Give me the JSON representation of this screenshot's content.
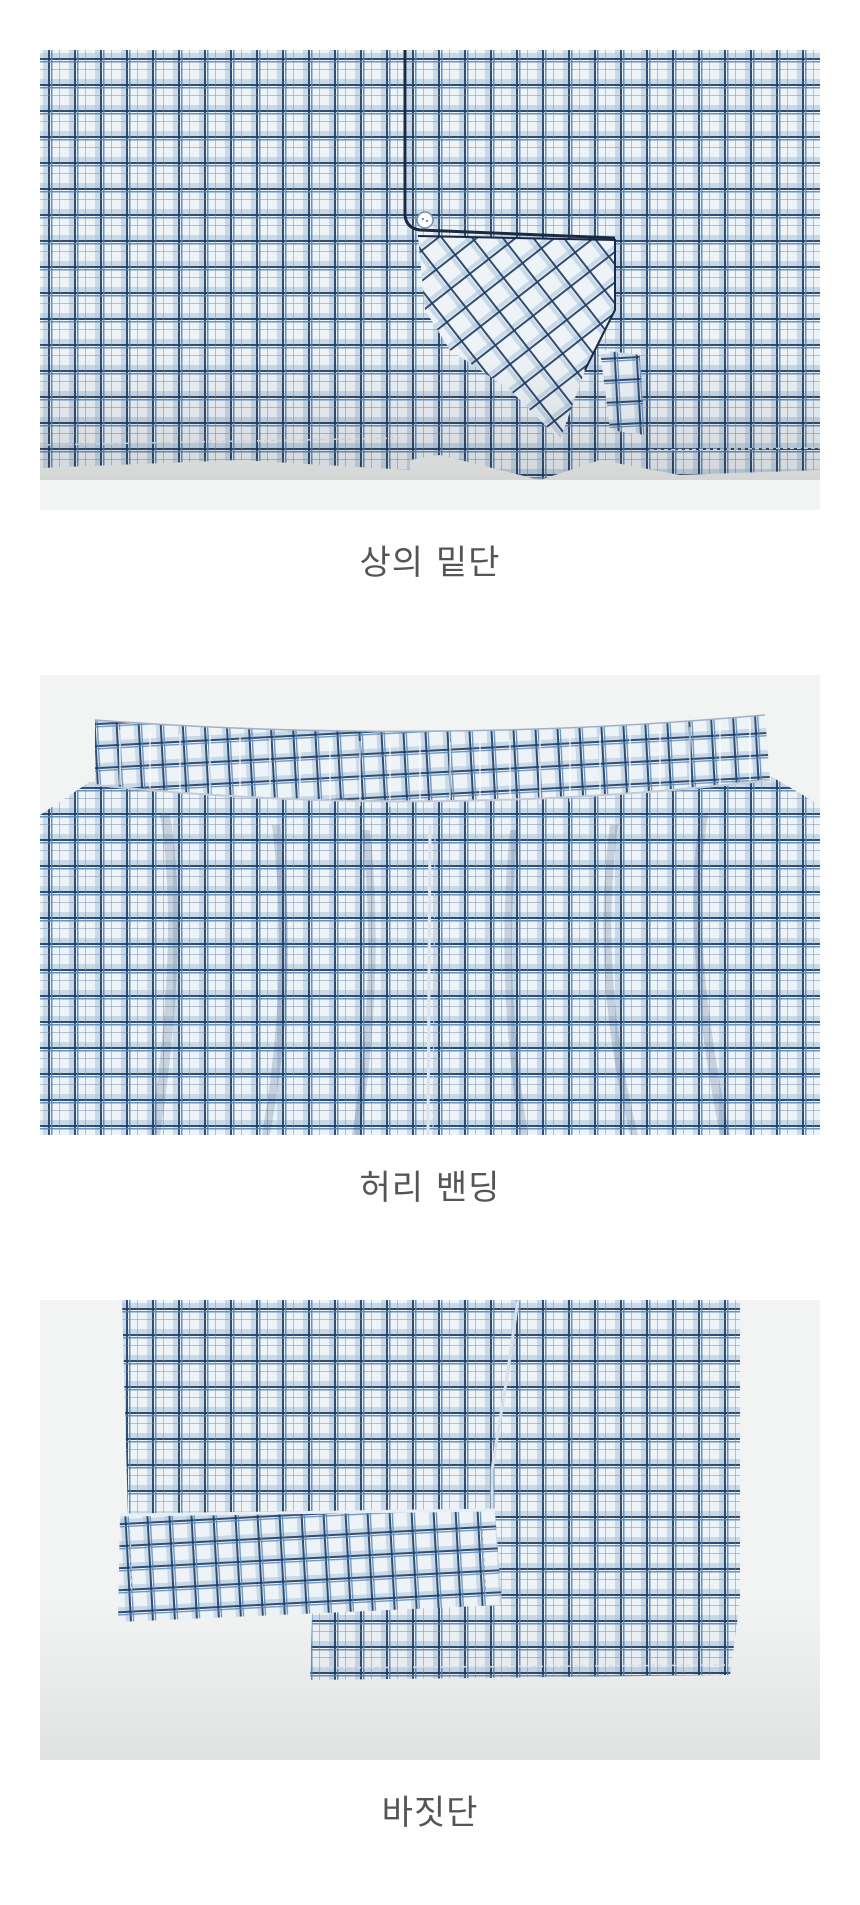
{
  "sections": [
    {
      "caption": "상의 밑단",
      "photo": "plaid-shirt-hem"
    },
    {
      "caption": "허리 밴딩",
      "photo": "plaid-pants-elastic-waistband"
    },
    {
      "caption": "바짓단",
      "photo": "plaid-pants-leg-hem"
    }
  ],
  "colors": {
    "background": "#ffffff",
    "photo_background": "#f2f3f3",
    "fabric_base": "#eef3f7",
    "check_navy": "#1f3b63",
    "check_blue": "#4f84b8",
    "check_light": "#a9c3dc",
    "caption_text": "#555555"
  }
}
